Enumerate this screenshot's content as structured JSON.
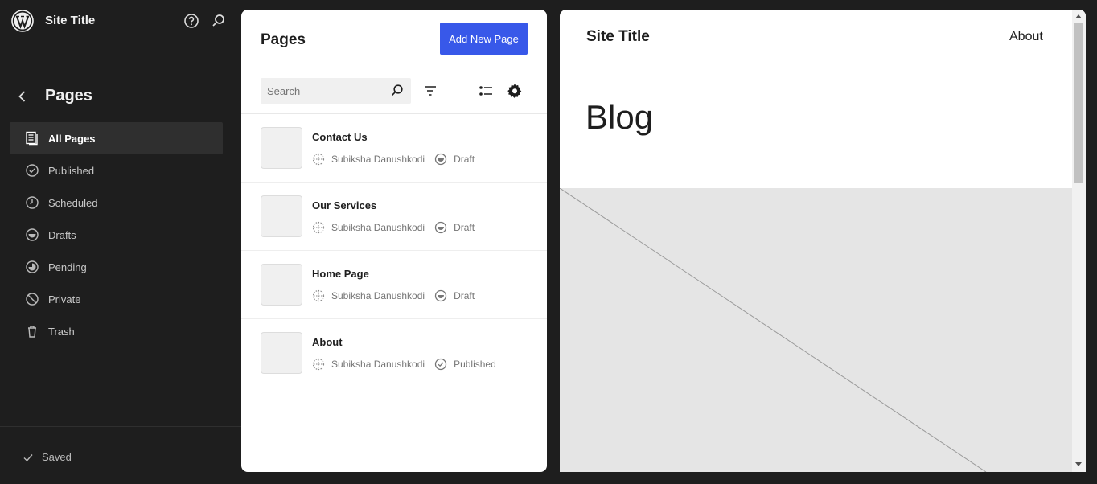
{
  "topbar": {
    "site_title": "Site Title",
    "icons": [
      "wordpress-logo-icon",
      "help-icon",
      "search-icon"
    ]
  },
  "sidebar": {
    "back_icon": "chevron-left-icon",
    "section_title": "Pages",
    "items": [
      {
        "label": "All Pages",
        "icon": "pages-icon",
        "active": true
      },
      {
        "label": "Published",
        "icon": "published-icon"
      },
      {
        "label": "Scheduled",
        "icon": "scheduled-icon"
      },
      {
        "label": "Drafts",
        "icon": "drafts-icon"
      },
      {
        "label": "Pending",
        "icon": "pending-icon"
      },
      {
        "label": "Private",
        "icon": "private-icon"
      },
      {
        "label": "Trash",
        "icon": "trash-icon"
      }
    ],
    "footer": {
      "saved_label": "Saved",
      "icon": "check-icon"
    }
  },
  "list_panel": {
    "title": "Pages",
    "add_button": "Add New Page",
    "search": {
      "placeholder": "Search",
      "value": ""
    },
    "toolbar_icons": [
      "filter-icon",
      "list-view-icon",
      "settings-icon"
    ],
    "rows": [
      {
        "title": "Contact Us",
        "author": "Subiksha Danushkodi",
        "status": "Draft"
      },
      {
        "title": "Our Services",
        "author": "Subiksha Danushkodi",
        "status": "Draft"
      },
      {
        "title": "Home Page",
        "author": "Subiksha Danushkodi",
        "status": "Draft"
      },
      {
        "title": "About",
        "author": "Subiksha Danushkodi",
        "status": "Published"
      }
    ]
  },
  "preview": {
    "site_title": "Site Title",
    "nav_link": "About",
    "heading": "Blog"
  },
  "colors": {
    "background": "#1e1e1e",
    "accent": "#3858e9",
    "active_nav": "#2f2f2f",
    "image_placeholder": "#e5e5e5"
  }
}
